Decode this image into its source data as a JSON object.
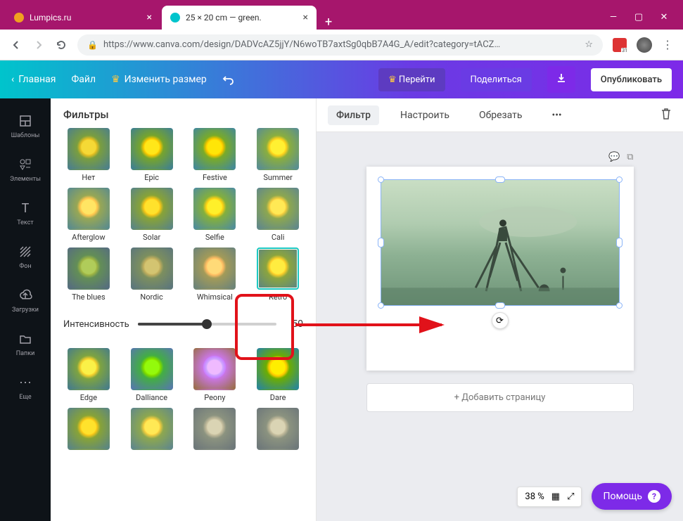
{
  "tabs": [
    {
      "label": "Lumpics.ru",
      "active": false,
      "icon_color": "#f0a020"
    },
    {
      "label": "25 × 20 cm — green.",
      "active": true,
      "icon_color": "#00c4cc"
    }
  ],
  "url": "https://www.canva.com/design/DADVcAZ5jjY/N6woTB7axtSg0qbB7A4G_A/edit?category=tACZ…",
  "ext_badge": "31",
  "toolbar": {
    "home": "Главная",
    "file": "Файл",
    "resize": "Изменить размер",
    "upgrade": "Перейти",
    "share": "Поделиться",
    "publish": "Опубликовать"
  },
  "side_nav": [
    {
      "key": "templates",
      "label": "Шаблоны"
    },
    {
      "key": "elements",
      "label": "Элементы"
    },
    {
      "key": "text",
      "label": "Текст"
    },
    {
      "key": "background",
      "label": "Фон"
    },
    {
      "key": "uploads",
      "label": "Загрузки"
    },
    {
      "key": "folders",
      "label": "Папки"
    },
    {
      "key": "more",
      "label": "Еще"
    }
  ],
  "panel": {
    "title": "Фильтры",
    "intensity_label": "Интенсивность",
    "intensity_value": "50"
  },
  "filters_row1": [
    {
      "name": "Нет",
      "cls": ""
    },
    {
      "name": "Epic",
      "cls": "f-epic"
    },
    {
      "name": "Festive",
      "cls": "f-festive"
    },
    {
      "name": "Summer",
      "cls": "f-summer"
    }
  ],
  "filters_row2": [
    {
      "name": "Afterglow",
      "cls": "f-afterglow"
    },
    {
      "name": "Solar",
      "cls": "f-solar"
    },
    {
      "name": "Selfie",
      "cls": "f-selfie"
    },
    {
      "name": "Cali",
      "cls": "f-cali"
    }
  ],
  "filters_row3": [
    {
      "name": "The blues",
      "cls": "f-blues"
    },
    {
      "name": "Nordic",
      "cls": "f-nordic"
    },
    {
      "name": "Whimsical",
      "cls": "f-whimsical"
    },
    {
      "name": "Retro",
      "cls": "f-retro",
      "selected": true
    }
  ],
  "filters_row4": [
    {
      "name": "Edge",
      "cls": "f-edge"
    },
    {
      "name": "Dalliance",
      "cls": "f-dalliance"
    },
    {
      "name": "Peony",
      "cls": "f-peony"
    },
    {
      "name": "Dare",
      "cls": "f-dare"
    }
  ],
  "filters_row5": [
    {
      "name": "",
      "cls": "f-solar"
    },
    {
      "name": "",
      "cls": "f-cali"
    },
    {
      "name": "",
      "cls": "f-gray"
    },
    {
      "name": "",
      "cls": "f-gray"
    }
  ],
  "context": {
    "filter": "Фильтр",
    "adjust": "Настроить",
    "crop": "Обрезать"
  },
  "add_page": "+ Добавить страницу",
  "zoom": "38 %",
  "help": "Помощь"
}
